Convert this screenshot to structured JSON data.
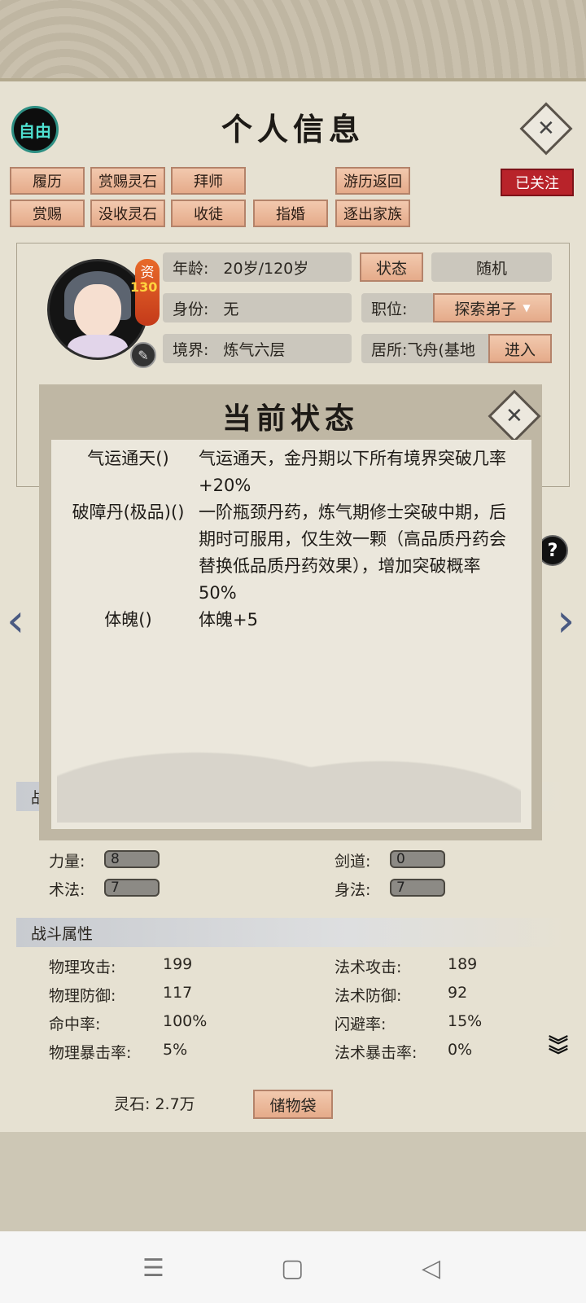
{
  "header": {
    "free_label": "自由",
    "title": "个人信息"
  },
  "buttons_row1": [
    "履历",
    "赏赐灵石",
    "拜师",
    "游历返回"
  ],
  "buttons_row2": [
    "赏赐",
    "没收灵石",
    "收徒",
    "指婚",
    "逐出家族"
  ],
  "follow_label": "已关注",
  "avatar": {
    "zi_label": "资",
    "zi_value": "130"
  },
  "info": {
    "age_label": "年龄:",
    "age_value": "20岁/120岁",
    "state_button": "状态",
    "random_button": "随机",
    "identity_label": "身份:",
    "identity_value": "无",
    "position_label": "职位:",
    "position_value": "探索弟子",
    "realm_label": "境界:",
    "realm_value": "炼气六层",
    "residence_label": "居所:",
    "residence_value": "飞舟(基地",
    "enter_button": "进入"
  },
  "attributes": {
    "strength_label": "力量:",
    "strength_value": "8",
    "sword_label": "剑道:",
    "sword_value": "0",
    "spell_label": "术法:",
    "spell_value": "7",
    "agility_label": "身法:",
    "agility_value": "7"
  },
  "combat": {
    "section_title": "战斗属性",
    "section_title_partial": "战",
    "rows": [
      {
        "l_label": "物理攻击:",
        "l_value": "199",
        "r_label": "法术攻击:",
        "r_value": "189"
      },
      {
        "l_label": "物理防御:",
        "l_value": "117",
        "r_label": "法术防御:",
        "r_value": "92"
      },
      {
        "l_label": "命中率:",
        "l_value": "100%",
        "r_label": "闪避率:",
        "r_value": "15%"
      },
      {
        "l_label": "物理暴击率:",
        "l_value": "5%",
        "r_label": "法术暴击率:",
        "r_value": "0%"
      }
    ]
  },
  "bottom": {
    "spirit_stone_label": "灵石: 2.7万",
    "bag_button": "储物袋"
  },
  "status_popup": {
    "title": "当前状态",
    "items": [
      {
        "name": "气运通天()",
        "desc": "气运通天，金丹期以下所有境界突破几率+20%"
      },
      {
        "name": "破障丹(极品)()",
        "desc": "一阶瓶颈丹药，炼气期修士突破中期，后期时可服用，仅生效一颗（高品质丹药会替换低品质丹药效果），增加突破概率50%"
      },
      {
        "name": "体魄()",
        "desc": "体魄+5"
      }
    ]
  },
  "icons": {
    "close": "close-icon",
    "help": "help-icon",
    "pen": "pen-icon"
  }
}
